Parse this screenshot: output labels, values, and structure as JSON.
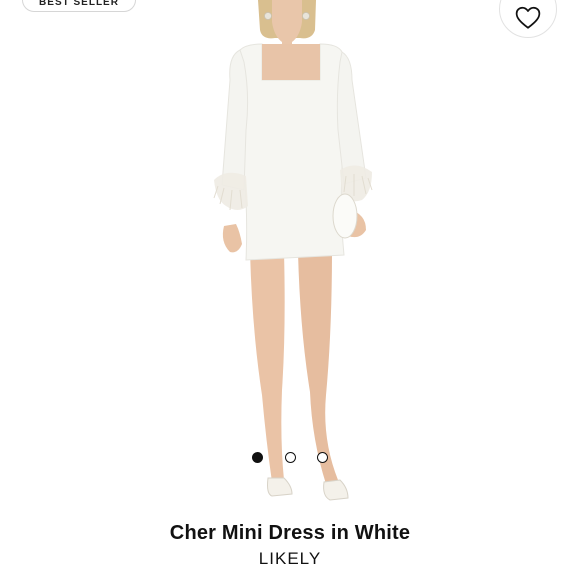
{
  "badge": {
    "label": "BEST SELLER"
  },
  "product": {
    "title": "Cher Mini Dress in White",
    "brand": "LIKELY"
  },
  "gallery": {
    "total": 3,
    "active": 1
  },
  "icons": {
    "favorite": "heart-outline-icon"
  },
  "colors": {
    "background": "#ffffff",
    "text": "#111111",
    "dress": "#f6f6f2"
  }
}
